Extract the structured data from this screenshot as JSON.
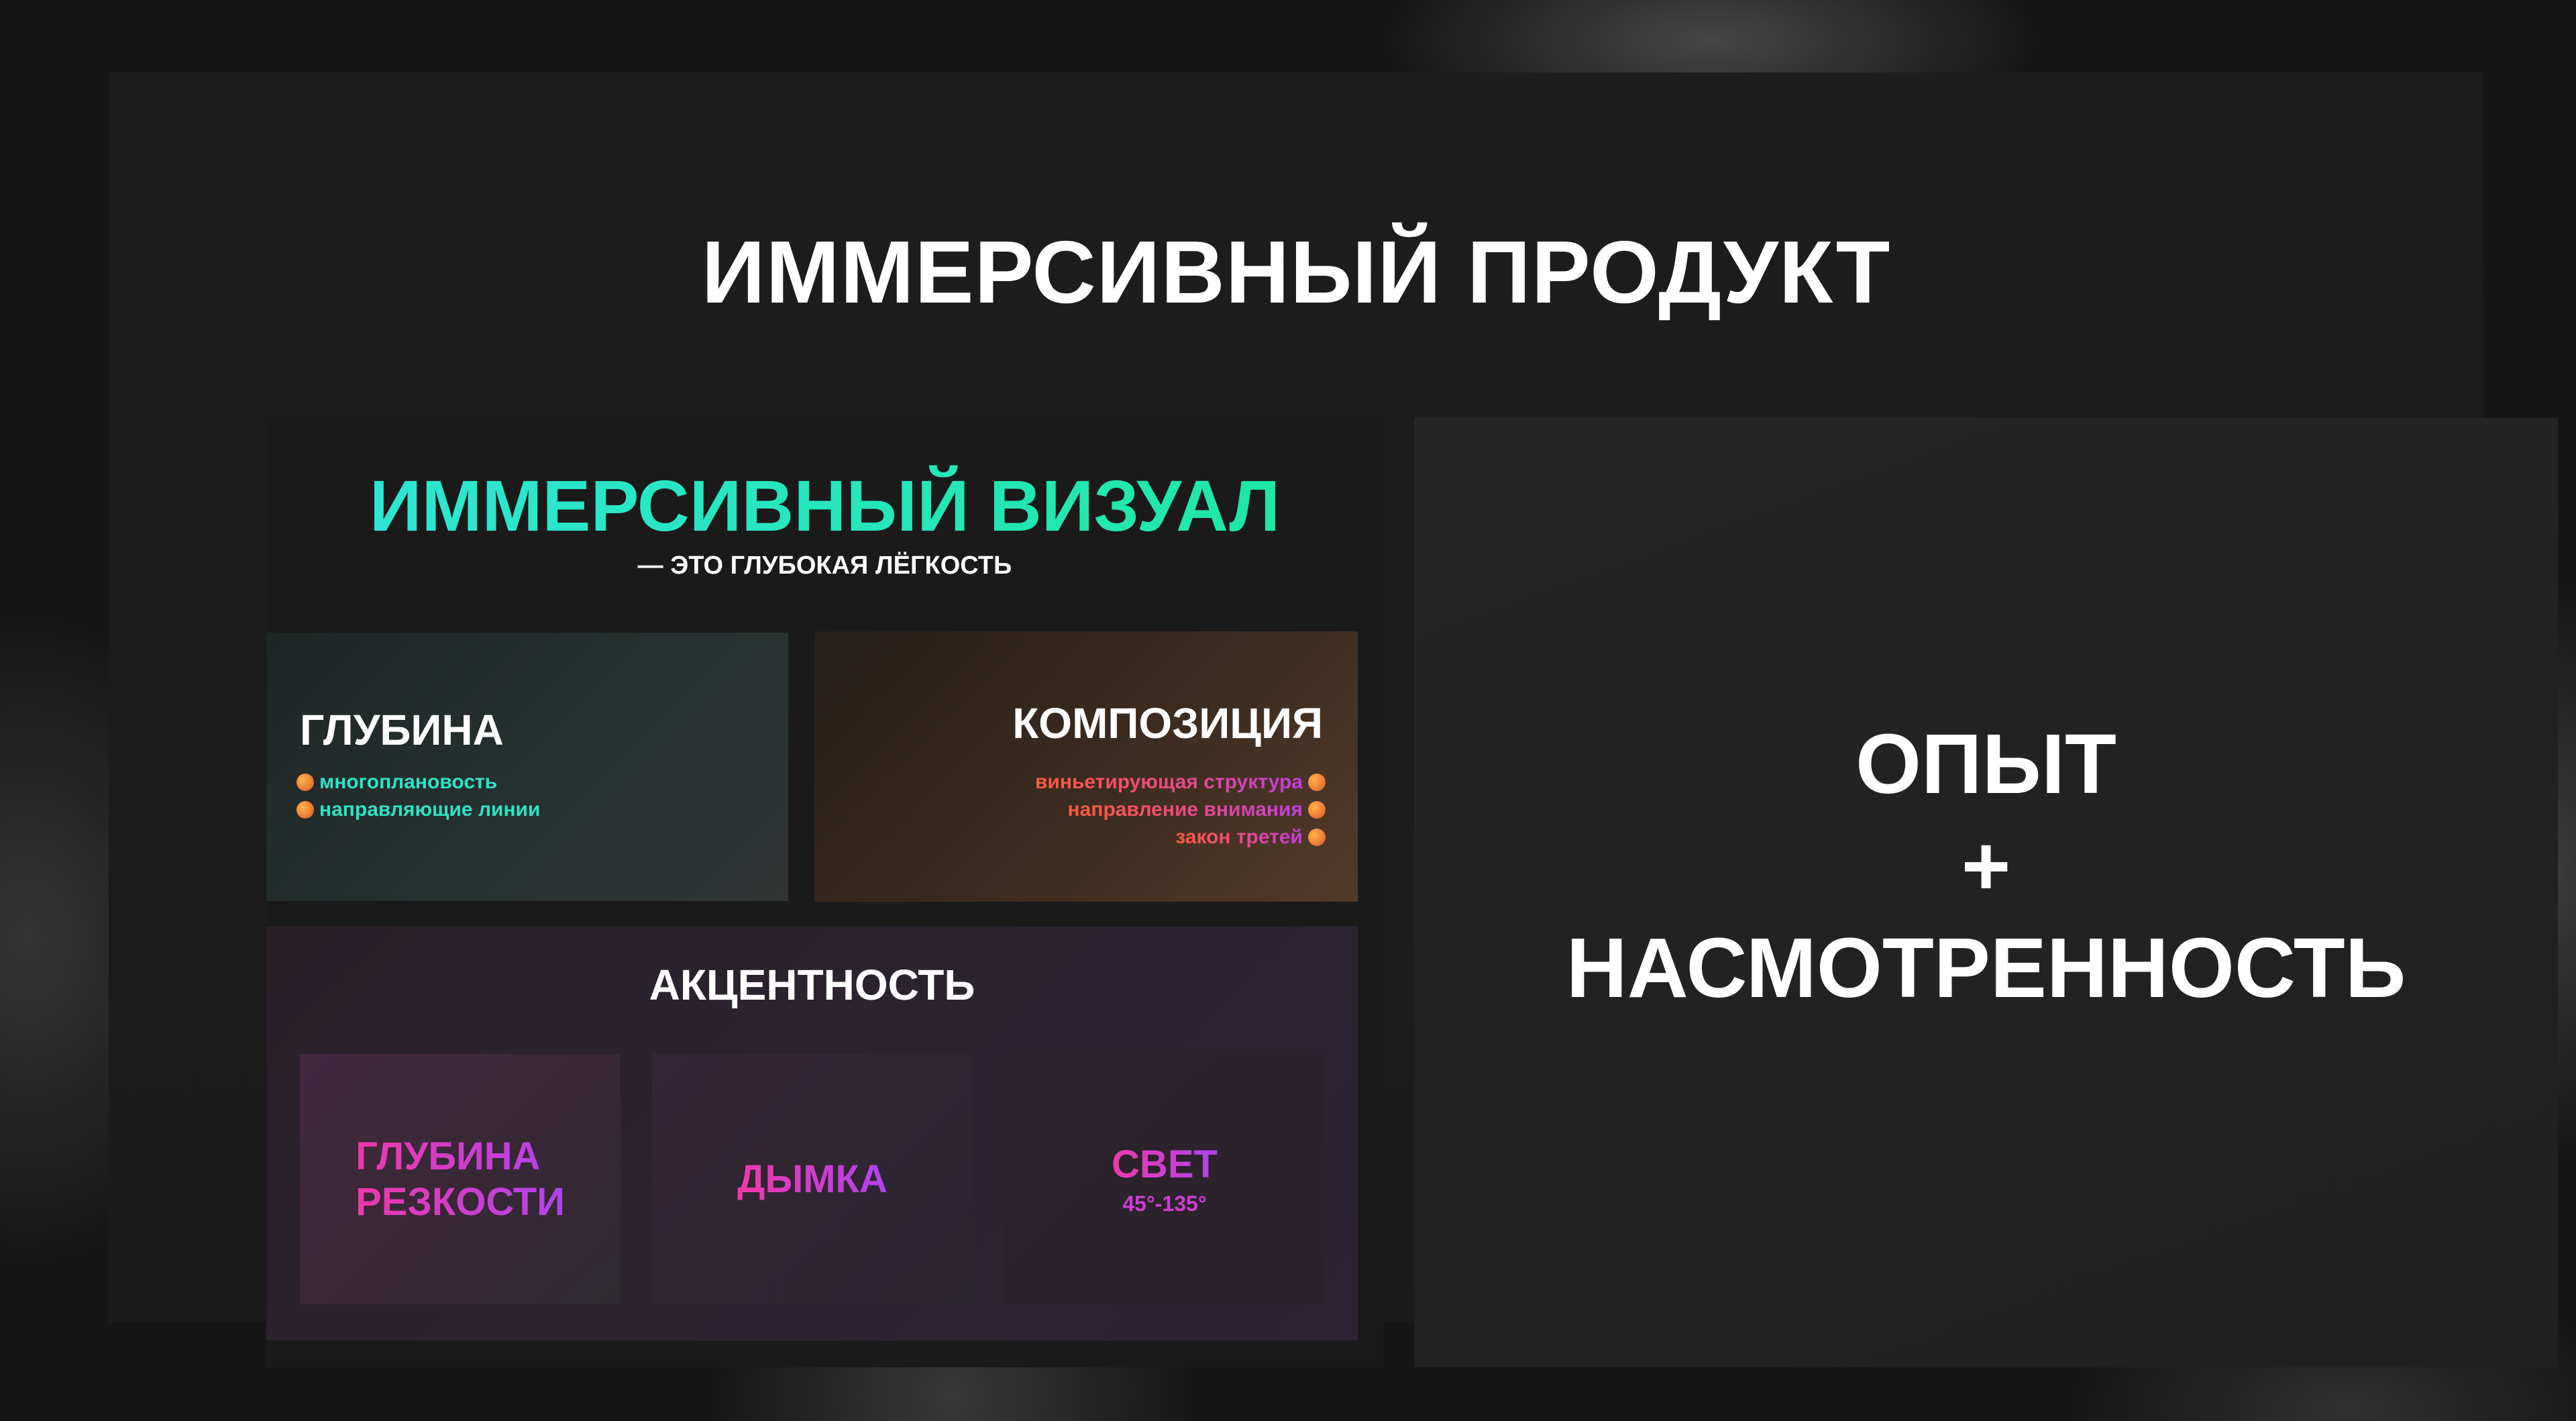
{
  "page": {
    "title": "ИММЕРСИВНЫЙ ПРОДУКТ"
  },
  "left": {
    "title": "ИММЕРСИВНЫЙ ВИЗУАЛ",
    "subtitle": "— ЭТО ГЛУБОКАЯ ЛЁГКОСТЬ",
    "depth": {
      "title": "ГЛУБИНА",
      "items": [
        "многоплановость",
        "направляющие линии"
      ]
    },
    "composition": {
      "title": "КОМПОЗИЦИЯ",
      "items": [
        "виньетирующая структура",
        "направление внимания",
        "закон третей"
      ]
    },
    "accent": {
      "title": "АКЦЕНТНОСТЬ",
      "tiles": [
        {
          "line1": "ГЛУБИНА",
          "line2": "РЕЗКОСТИ"
        },
        {
          "line1": "ДЫМКА"
        },
        {
          "line1": "СВЕТ",
          "sub": "45°-135°"
        }
      ]
    }
  },
  "right": {
    "line1": "ОПЫТ",
    "line2": "+",
    "line3": "НАСМОТРЕННОСТЬ"
  },
  "colors": {
    "background": "#161616",
    "panel": "#1d1d1d",
    "teal_accent": "#27e6b4",
    "magenta_accent": "#d83ce0",
    "orange_dot": "#f08a3a"
  }
}
